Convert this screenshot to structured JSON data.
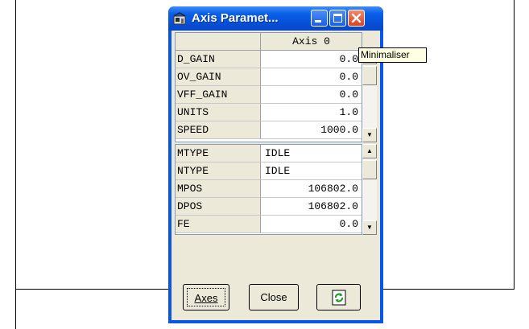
{
  "window": {
    "title": "Axis Paramet...",
    "column_header": "Axis 0",
    "tooltip": "Minimaliser"
  },
  "top_table": {
    "rows": [
      {
        "name": "D_GAIN",
        "value": "0.0"
      },
      {
        "name": "OV_GAIN",
        "value": "0.0"
      },
      {
        "name": "VFF_GAIN",
        "value": "0.0"
      },
      {
        "name": "UNITS",
        "value": "1.0"
      },
      {
        "name": "SPEED",
        "value": "1000.0"
      }
    ]
  },
  "bottom_table": {
    "rows": [
      {
        "name": "MTYPE",
        "value": "IDLE"
      },
      {
        "name": "NTYPE",
        "value": "IDLE"
      },
      {
        "name": "MPOS",
        "value": "106802.0"
      },
      {
        "name": "DPOS",
        "value": "106802.0"
      },
      {
        "name": "FE",
        "value": "0.0"
      }
    ]
  },
  "buttons": {
    "axes": "Axes",
    "close": "Close"
  },
  "icons": {
    "app": "app-icon",
    "minimize": "minimize-icon",
    "maximize": "maximize-icon",
    "close": "close-icon",
    "refresh": "refresh-icon"
  }
}
